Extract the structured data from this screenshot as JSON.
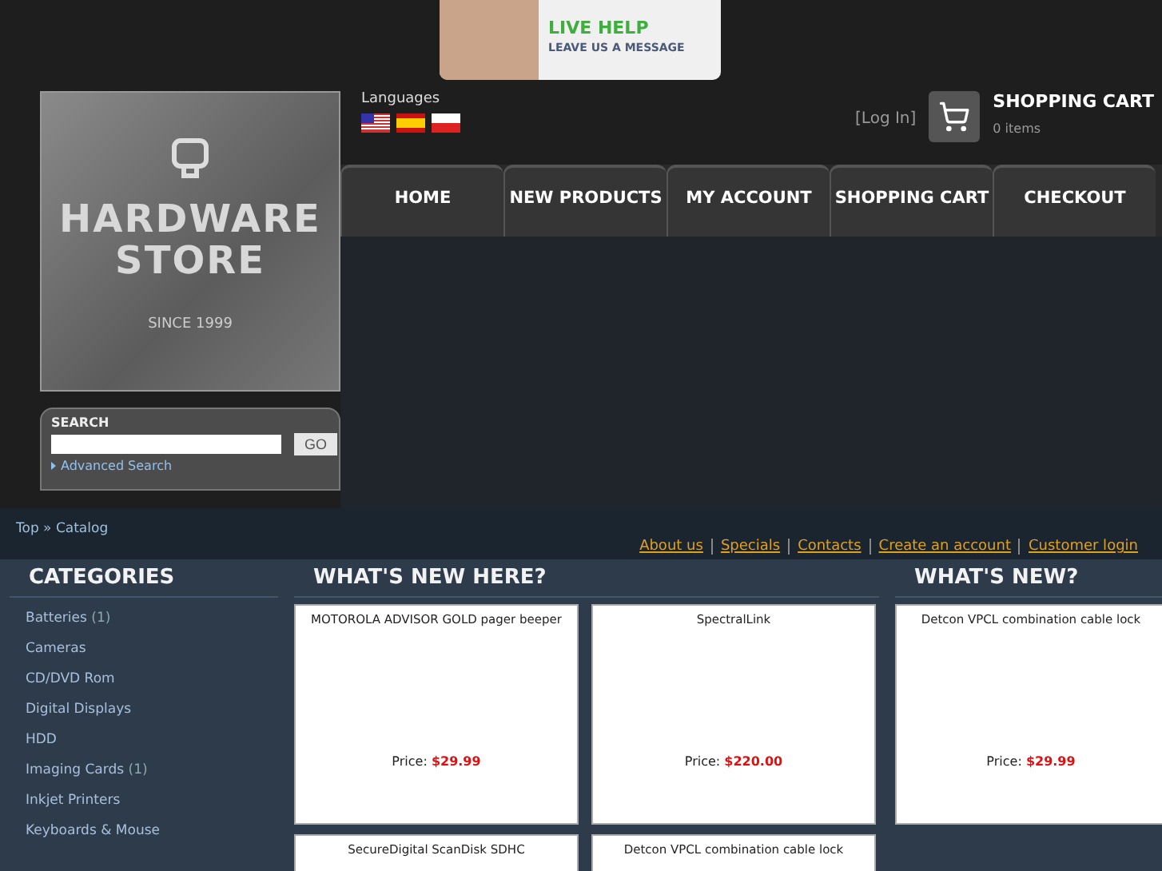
{
  "banner": {
    "title": "LIVE HELP",
    "subtitle": "LEAVE US A MESSAGE"
  },
  "languages": {
    "label": "Languages",
    "flags": [
      {
        "kind": "us"
      },
      {
        "kind": "es"
      },
      {
        "kind": "pl"
      }
    ]
  },
  "login": "[Log In]",
  "cart": {
    "title": "SHOPPING CART",
    "items": "0 items"
  },
  "logo": {
    "line1": "HARDWARE",
    "line2": "STORE",
    "since": "SINCE 1999"
  },
  "nav": [
    {
      "label": "HOME"
    },
    {
      "label": "NEW PRODUCTS"
    },
    {
      "label": "MY ACCOUNT"
    },
    {
      "label": "SHOPPING CART"
    },
    {
      "label": "CHECKOUT"
    }
  ],
  "search": {
    "title": "SEARCH",
    "button": "GO",
    "advanced": "Advanced Search"
  },
  "breadcrumb": {
    "top": "Top",
    "separator": "»",
    "current": "Catalog"
  },
  "links": [
    "About us",
    "Specials",
    "Contacts",
    "Create an account",
    "Customer login"
  ],
  "categories": {
    "title": "CATEGORIES",
    "items": [
      {
        "name": "Batteries",
        "count": "(1)"
      },
      {
        "name": "Cameras"
      },
      {
        "name": "CD/DVD Rom"
      },
      {
        "name": "Digital Displays"
      },
      {
        "name": "HDD"
      },
      {
        "name": "Imaging Cards",
        "count": "(1)"
      },
      {
        "name": "Inkjet Printers"
      },
      {
        "name": "Keyboards & Mouse"
      }
    ]
  },
  "whats_new_here": {
    "title": "WHAT'S NEW HERE?",
    "products": [
      {
        "name": "MOTOROLA ADVISOR GOLD pager beeper",
        "price_label": "Price:",
        "price": "$29.99"
      },
      {
        "name": "SpectralLink",
        "price_label": "Price:",
        "price": "$220.00"
      },
      {
        "name": "SecureDigital ScanDisk SDHC"
      },
      {
        "name": "Detcon VPCL combination cable lock"
      }
    ]
  },
  "whats_new": {
    "title": "WHAT'S NEW?",
    "product": {
      "name": "Detcon VPCL combination cable lock",
      "price_label": "Price:",
      "price": "$29.99"
    }
  }
}
